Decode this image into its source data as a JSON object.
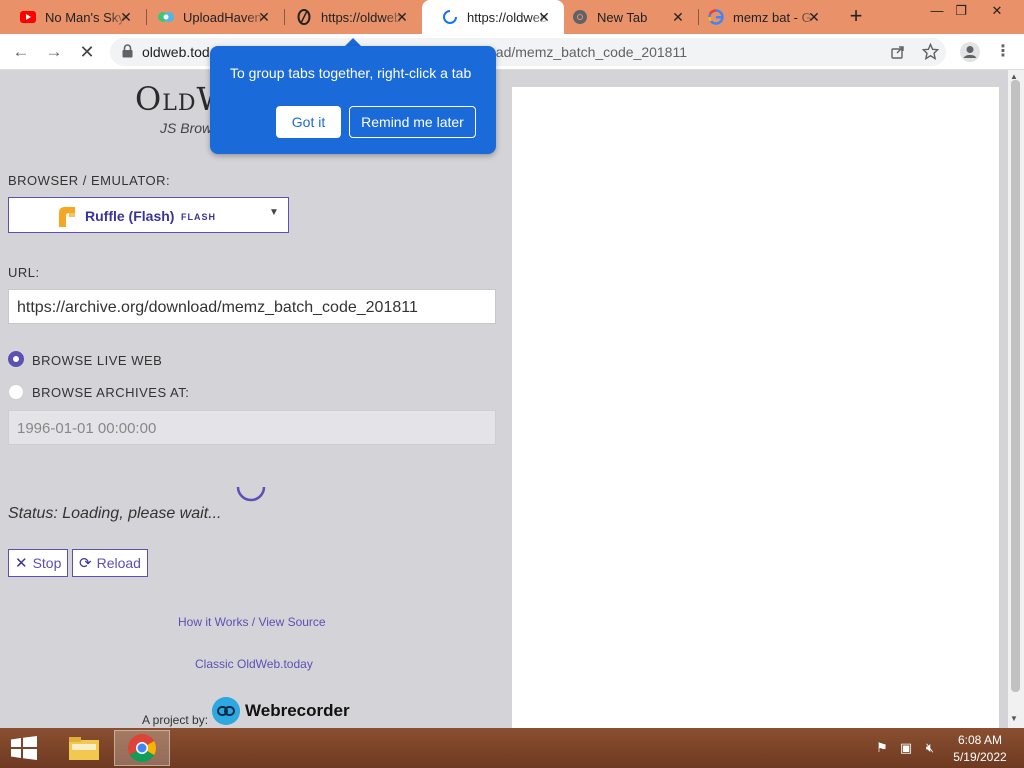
{
  "tabs": [
    {
      "title": "No Man's Sky",
      "icon": "youtube-icon",
      "active": false
    },
    {
      "title": "UploadHaven",
      "icon": "uploadhaven-icon",
      "active": false
    },
    {
      "title": "https://oldweb",
      "icon": "oldweb-icon",
      "active": false
    },
    {
      "title": "https://oldweb",
      "icon": "loading-spinner-icon",
      "active": true
    },
    {
      "title": "New Tab",
      "icon": "chrome-icon",
      "active": false
    },
    {
      "title": "memz bat - G",
      "icon": "google-icon",
      "active": false
    }
  ],
  "window_controls": {
    "minimize": "—",
    "restore": "❐",
    "close": "✕"
  },
  "address_bar": {
    "url_visible_start": "oldweb.tod",
    "url_visible_end": "oad/memz_batch_code_201811"
  },
  "popup": {
    "text": "To group tabs together, right-click a tab",
    "got_it": "Got it",
    "remind_later": "Remind me later"
  },
  "page": {
    "logo_text": "OldW",
    "logo_sub": "JS Brow",
    "browser_label": "Browser / Emulator:",
    "emulator_selected": "Ruffle (Flash)",
    "emulator_tag": "FLASH",
    "url_label": "URL:",
    "url_value": "https://archive.org/download/memz_batch_code_201811",
    "radio_live": "Browse live web",
    "radio_archives": "Browse archives at:",
    "date_placeholder": "1996-01-01 00:00:00",
    "status": "Status: Loading, please wait...",
    "stop_label": "Stop",
    "reload_label": "Reload",
    "link_how": "How it Works / View Source",
    "link_classic": "Classic OldWeb.today",
    "project_by": "A project by:",
    "webrecorder": "Webrecorder"
  },
  "taskbar": {
    "time": "6:08 AM",
    "date": "5/19/2022"
  },
  "colors": {
    "tabstrip": "#e9926a",
    "accent": "#5b50b4",
    "popup_blue": "#1a6ad9",
    "page_bg": "#d4d4d8"
  }
}
